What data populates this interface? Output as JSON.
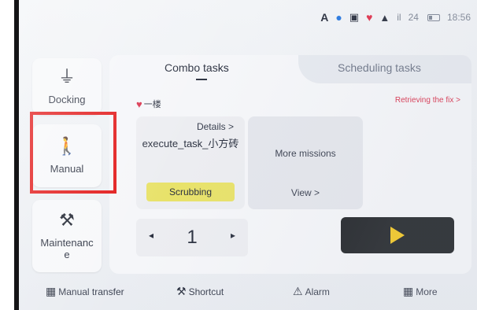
{
  "status_bar": {
    "keyboard_indicator": "A",
    "signal": "il",
    "clock": "24",
    "time": "18:56",
    "icons": [
      "drop-icon",
      "calendar-icon",
      "location-pin-icon",
      "cloud-icon",
      "signal-icon",
      "battery-icon"
    ]
  },
  "sidebar": {
    "items": [
      {
        "label": "Docking",
        "icon": "plug-icon"
      },
      {
        "label": "Manual",
        "icon": "manual-operator-icon"
      },
      {
        "label": "Maintenanc\ne",
        "icon": "tools-icon"
      }
    ]
  },
  "tabs": {
    "combo": "Combo tasks",
    "scheduling": "Scheduling tasks"
  },
  "location": {
    "floor": "一楼",
    "retrieve": "Retrieving the fix >"
  },
  "task_card": {
    "details": "Details >",
    "name": "execute_task_小方砖",
    "status": "Scrubbing"
  },
  "more_card": {
    "title": "More missions",
    "view": "View >"
  },
  "stepper": {
    "value": "1",
    "prev": "◂",
    "next": "▸"
  },
  "bottom_bar": {
    "transfer": "Manual transfer",
    "shortcut": "Shortcut",
    "alarm": "Alarm",
    "more": "More"
  },
  "colors": {
    "highlight": "#e21818",
    "status_badge": "#e8e26a",
    "play": "#f3c61c",
    "accent_red": "#d9304b"
  }
}
